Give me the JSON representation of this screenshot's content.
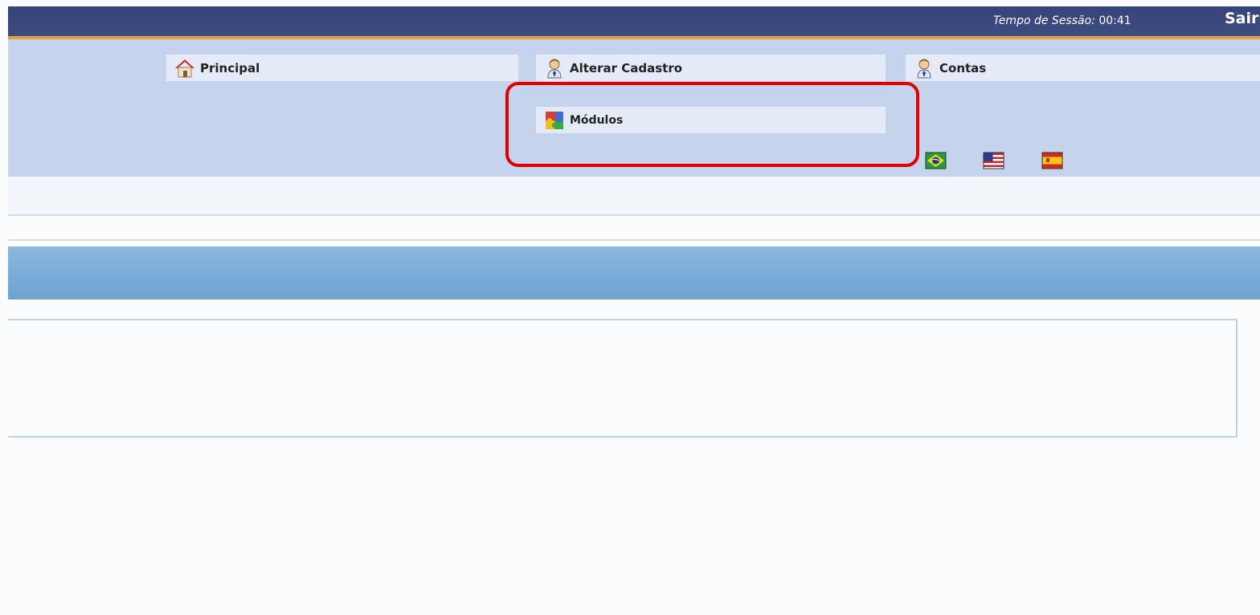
{
  "header": {
    "session_label": "Tempo de Sessão",
    "session_sep": ":",
    "session_time": "00:41",
    "logout_label": "Sair",
    "accent_color": "#e5a23a",
    "bar_color": "#3a4880"
  },
  "menu": {
    "principal": {
      "label": "Principal",
      "icon": "home-icon"
    },
    "alterar_cadastro": {
      "label": "Alterar Cadastro",
      "icon": "user-icon"
    },
    "contas": {
      "label": "Contas",
      "icon": "user-icon"
    },
    "modulos": {
      "label": "Módulos",
      "icon": "puzzle-icon"
    }
  },
  "languages": [
    {
      "name": "brazil-flag-icon"
    },
    {
      "name": "usa-flag-icon"
    },
    {
      "name": "spain-flag-icon"
    }
  ],
  "annotation": {
    "highlight_color": "#e00000"
  }
}
